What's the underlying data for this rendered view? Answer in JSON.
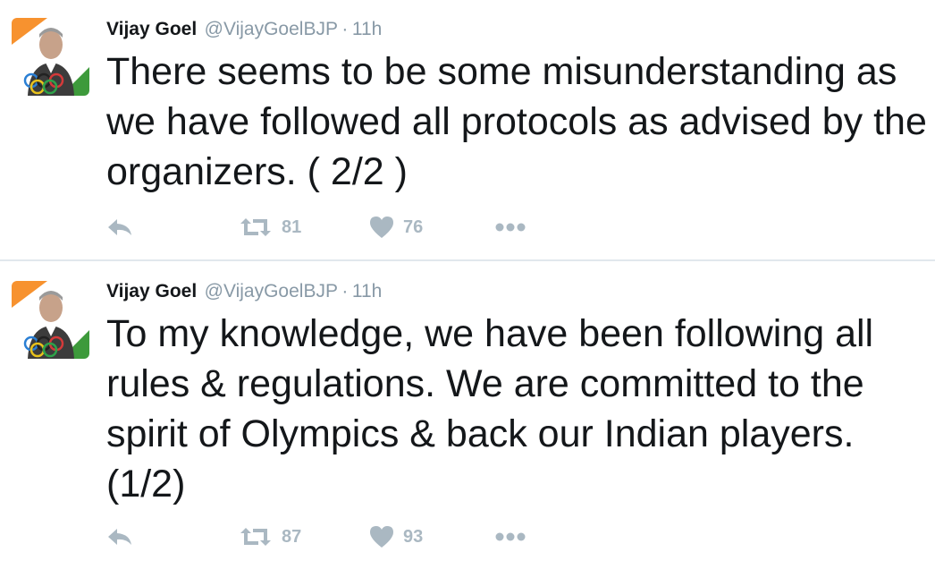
{
  "colors": {
    "text": "#14171a",
    "muted": "#8899a6",
    "action_icon": "#aab8c2",
    "divider": "#e1e8ed"
  },
  "tweets": [
    {
      "author_name": "Vijay Goel",
      "author_handle": "@VijayGoelBJP",
      "separator": "·",
      "timestamp": "11h",
      "text": "There seems to be some misunderstanding as we have followed all protocols as advised by the organizers. ( 2/2 )",
      "retweet_count": "81",
      "like_count": "76",
      "icons": [
        "reply-icon",
        "retweet-icon",
        "heart-icon",
        "more-icon"
      ]
    },
    {
      "author_name": "Vijay Goel",
      "author_handle": "@VijayGoelBJP",
      "separator": "·",
      "timestamp": "11h",
      "text": "To my knowledge, we have been following all rules & regulations. We are committed to the spirit of Olympics & back our Indian players. (1/2)",
      "retweet_count": "87",
      "like_count": "93",
      "icons": [
        "reply-icon",
        "retweet-icon",
        "heart-icon",
        "more-icon"
      ]
    }
  ]
}
